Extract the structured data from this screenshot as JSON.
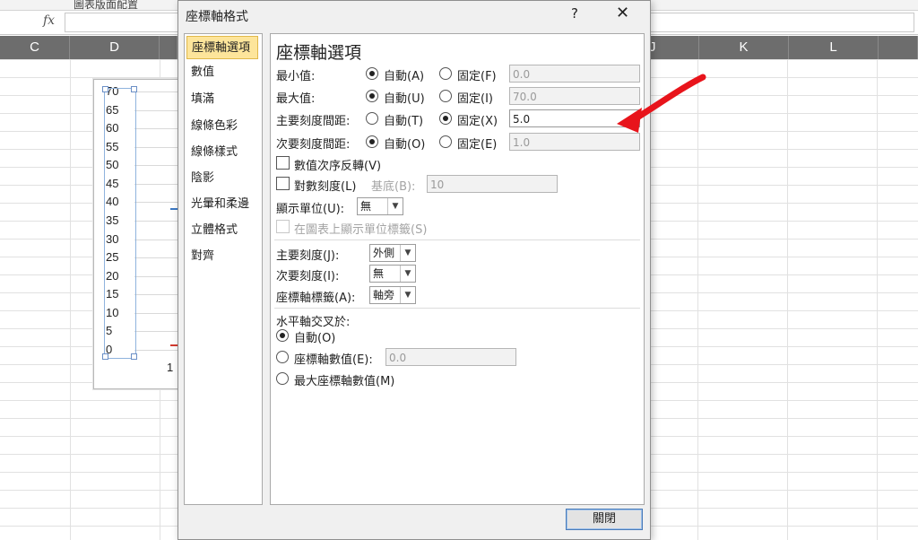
{
  "ribbon": {
    "group_label": "圖表版面配置"
  },
  "formula": {
    "fx_label": "fx"
  },
  "columns": [
    {
      "label": "C"
    },
    {
      "label": "D"
    },
    {
      "label": "J"
    },
    {
      "label": "K"
    },
    {
      "label": "L"
    }
  ],
  "chart": {
    "y_ticks": [
      "70",
      "65",
      "60",
      "55",
      "50",
      "45",
      "40",
      "35",
      "30",
      "25",
      "20",
      "15",
      "10",
      "5",
      "0"
    ],
    "x_tick": "1",
    "ylim": [
      0,
      70
    ],
    "major_unit": 5
  },
  "dialog": {
    "title": "座標軸格式",
    "help": "?",
    "close_x": "✕",
    "nav": [
      "座標軸選項",
      "數值",
      "填滿",
      "線條色彩",
      "線條樣式",
      "陰影",
      "光暈和柔邊",
      "立體格式",
      "對齊"
    ],
    "panel_title": "座標軸選項",
    "min": {
      "label": "最小值:",
      "auto": "自動(A)",
      "fixed": "固定(F)",
      "value": "0.0"
    },
    "max": {
      "label": "最大值:",
      "auto": "自動(U)",
      "fixed": "固定(I)",
      "value": "70.0"
    },
    "major": {
      "label": "主要刻度間距:",
      "auto": "自動(T)",
      "fixed": "固定(X)",
      "value": "5.0"
    },
    "minor": {
      "label": "次要刻度間距:",
      "auto": "自動(O)",
      "fixed": "固定(E)",
      "value": "1.0"
    },
    "reverse": "數值次序反轉(V)",
    "log": {
      "label": "對數刻度(L)",
      "base_label": "基底(B):",
      "base_value": "10"
    },
    "display_units": {
      "label": "顯示單位(U):",
      "value": "無"
    },
    "show_units_label": "在圖表上顯示單位標籤(S)",
    "major_tick": {
      "label": "主要刻度(J):",
      "value": "外側"
    },
    "minor_tick": {
      "label": "次要刻度(I):",
      "value": "無"
    },
    "axis_labels": {
      "label": "座標軸標籤(A):",
      "value": "軸旁"
    },
    "cross": {
      "label": "水平軸交叉於:",
      "auto": "自動(O)",
      "axis_value": "座標軸數值(E):",
      "axis_value_field": "0.0",
      "max_value": "最大座標軸數值(M)"
    },
    "close_button": "關閉"
  },
  "colors": {
    "annotation_arrow": "#e8141b",
    "nav_active": "#fde59b",
    "column_header_bg": "#6d6d6d"
  }
}
